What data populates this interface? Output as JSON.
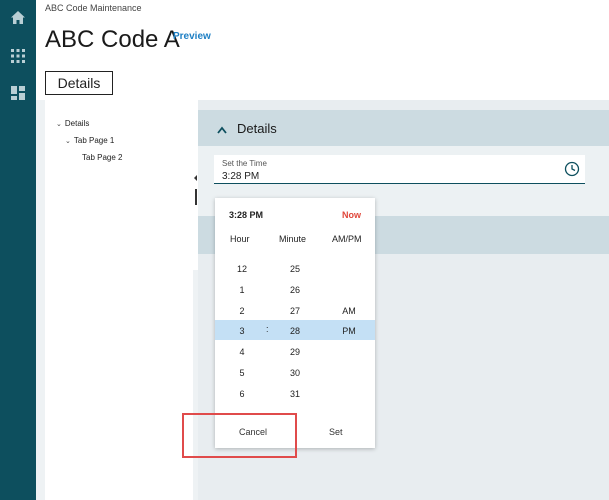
{
  "nav": {
    "icons": [
      "home-icon",
      "apps-grid-icon",
      "dashboard-icon"
    ],
    "accent": "#0d4f5e"
  },
  "header": {
    "breadcrumb": "ABC Code Maintenance",
    "title": "ABC Code A",
    "preview": "Preview",
    "details_tab": "Details"
  },
  "tree": {
    "items": [
      {
        "label": "Details",
        "expanded": true
      },
      {
        "label": "Tab Page 1",
        "expanded": true
      },
      {
        "label": "Tab Page 2"
      }
    ]
  },
  "section": {
    "title": "Details",
    "field": {
      "label": "Set the Time",
      "value": "3:28 PM"
    }
  },
  "picker": {
    "current": "3:28 PM",
    "now_label": "Now",
    "headers": {
      "hour": "Hour",
      "minute": "Minute",
      "ampm": "AM/PM"
    },
    "separator": ":",
    "rows": [
      {
        "hour": "12",
        "minute": "25",
        "ampm": ""
      },
      {
        "hour": "1",
        "minute": "26",
        "ampm": ""
      },
      {
        "hour": "2",
        "minute": "27",
        "ampm": "AM"
      },
      {
        "hour": "3",
        "minute": "28",
        "ampm": "PM",
        "selected": true
      },
      {
        "hour": "4",
        "minute": "29",
        "ampm": ""
      },
      {
        "hour": "5",
        "minute": "30",
        "ampm": ""
      },
      {
        "hour": "6",
        "minute": "31",
        "ampm": ""
      }
    ],
    "cancel": "Cancel",
    "set": "Set",
    "highlight_color": "#c4e0f5",
    "now_color": "#e0463a"
  },
  "annotation_color": "#e04b4b"
}
